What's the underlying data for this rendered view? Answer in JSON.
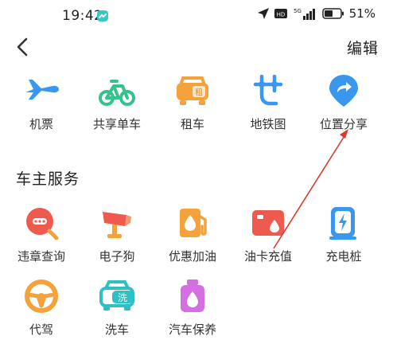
{
  "status_bar": {
    "time": "19:42",
    "battery_percent": "51%"
  },
  "header": {
    "edit_label": "编辑"
  },
  "quick_items": [
    {
      "label": "机票",
      "icon": "airplane-icon"
    },
    {
      "label": "共享单车",
      "icon": "bicycle-icon"
    },
    {
      "label": "租车",
      "icon": "car-rental-icon"
    },
    {
      "label": "地铁图",
      "icon": "metro-map-icon"
    },
    {
      "label": "位置分享",
      "icon": "location-share-icon"
    }
  ],
  "car_services": {
    "title": "车主服务",
    "items": [
      {
        "label": "违章查询",
        "icon": "violation-search-icon"
      },
      {
        "label": "电子狗",
        "icon": "speed-camera-icon"
      },
      {
        "label": "优惠加油",
        "icon": "fuel-discount-icon"
      },
      {
        "label": "油卡充值",
        "icon": "fuel-card-recharge-icon"
      },
      {
        "label": "充电桩",
        "icon": "charging-pile-icon"
      },
      {
        "label": "代驾",
        "icon": "steering-wheel-icon"
      },
      {
        "label": "洗车",
        "icon": "car-wash-icon",
        "icon_text": "洗"
      },
      {
        "label": "汽车保养",
        "icon": "engine-oil-icon"
      }
    ]
  },
  "colors": {
    "blue": "#3a97f0",
    "green": "#33c48c",
    "orange": "#f5a23c",
    "teal": "#2ec0c5",
    "red": "#ef5a4e",
    "pink": "#d46fe0",
    "arrow_red": "#d93a2b"
  }
}
